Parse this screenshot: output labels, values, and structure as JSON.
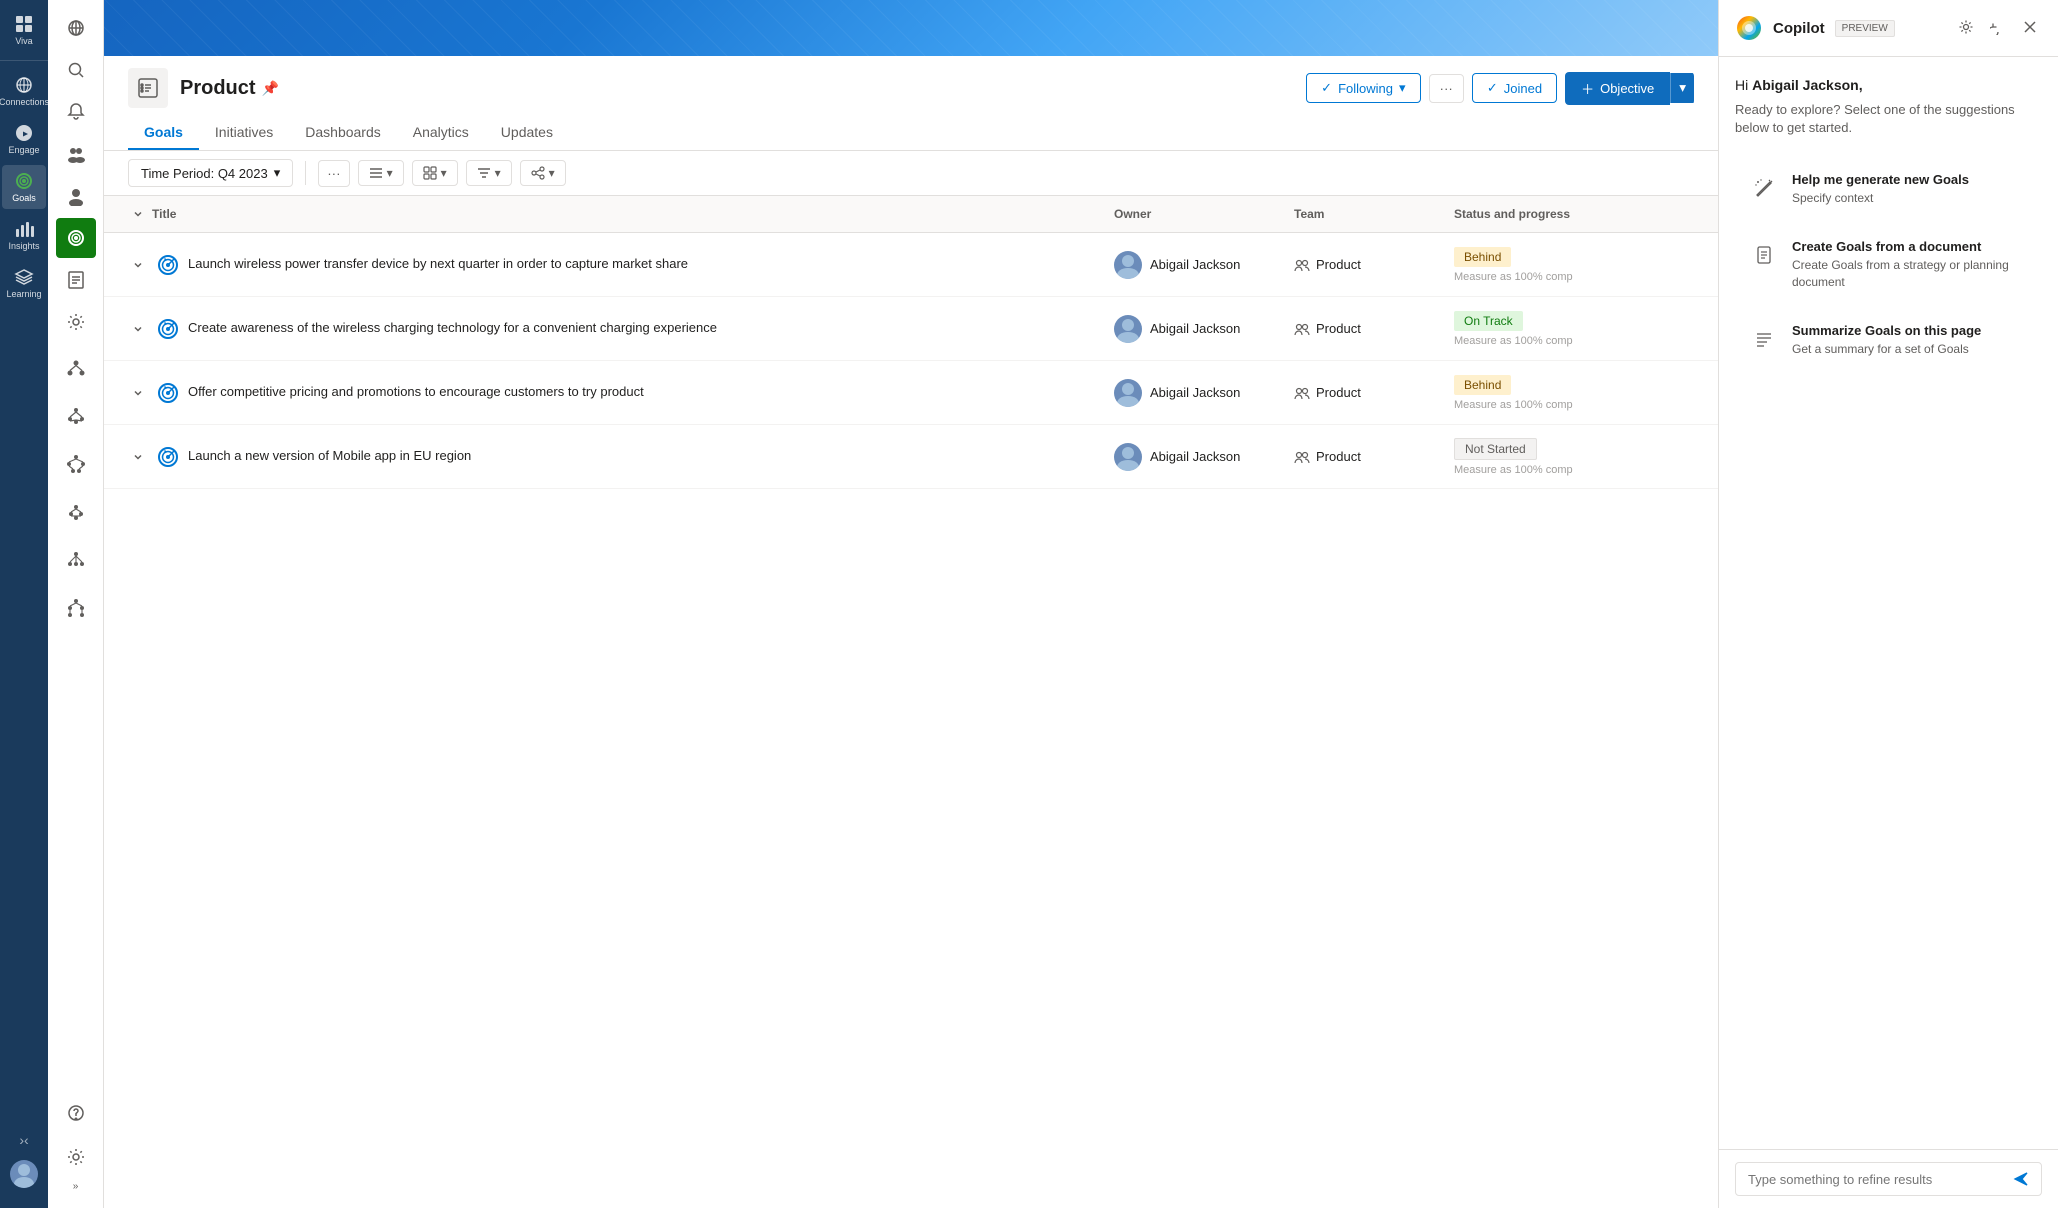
{
  "app": {
    "title": "Goals"
  },
  "far_left_nav": {
    "items": [
      {
        "id": "viva",
        "label": "Viva",
        "icon": "grid"
      },
      {
        "id": "connections",
        "label": "Connections",
        "icon": "globe"
      },
      {
        "id": "engage",
        "label": "Engage",
        "icon": "engage"
      },
      {
        "id": "goals",
        "label": "Goals",
        "icon": "goals",
        "active": true
      },
      {
        "id": "insights",
        "label": "Insights",
        "icon": "insights"
      },
      {
        "id": "learning",
        "label": "Learning",
        "icon": "learning"
      }
    ]
  },
  "left_sidebar": {
    "icons": [
      "globe",
      "search",
      "bell",
      "team-group",
      "people",
      "report",
      "settings"
    ]
  },
  "page": {
    "title": "Product",
    "pin_icon": "📌",
    "tabs": [
      {
        "id": "goals",
        "label": "Goals",
        "active": true
      },
      {
        "id": "initiatives",
        "label": "Initiatives",
        "active": false
      },
      {
        "id": "dashboards",
        "label": "Dashboards",
        "active": false
      },
      {
        "id": "analytics",
        "label": "Analytics",
        "active": false
      },
      {
        "id": "updates",
        "label": "Updates",
        "active": false
      }
    ],
    "actions": {
      "following_label": "Following",
      "joined_label": "Joined",
      "objective_label": "Objective"
    }
  },
  "toolbar": {
    "time_period": "Time Period: Q4 2023"
  },
  "table": {
    "columns": [
      "Title",
      "Owner",
      "Team",
      "Status and progress"
    ],
    "rows": [
      {
        "id": 1,
        "title": "Launch wireless power transfer device by next quarter in order to capture market share",
        "owner": "Abigail Jackson",
        "team": "Product",
        "status": "Behind",
        "status_type": "behind",
        "measure": "Measure as 100% comp"
      },
      {
        "id": 2,
        "title": "Create awareness of the wireless charging technology for a convenient charging experience",
        "owner": "Abigail Jackson",
        "team": "Product",
        "status": "On Track",
        "status_type": "on-track",
        "measure": "Measure as 100% comp"
      },
      {
        "id": 3,
        "title": "Offer competitive pricing and promotions to encourage customers to try product",
        "owner": "Abigail Jackson",
        "team": "Product",
        "status": "Behind",
        "status_type": "behind",
        "measure": "Measure as 100% comp"
      },
      {
        "id": 4,
        "title": "Launch a new version of Mobile app in EU region",
        "owner": "Abigail Jackson",
        "team": "Product",
        "status": "Not Started",
        "status_type": "not-started",
        "measure": "Measure as 100% comp"
      }
    ]
  },
  "copilot": {
    "title": "Copilot",
    "preview_badge": "PREVIEW",
    "greeting": "Hi Abigail Jackson,",
    "subtext": "Ready to explore? Select one of the suggestions below to get started.",
    "suggestions": [
      {
        "id": "generate",
        "icon": "wand",
        "title": "Help me generate new Goals",
        "description": "Specify context"
      },
      {
        "id": "from-doc",
        "icon": "document",
        "title": "Create Goals from a document",
        "description": "Create Goals from a strategy or planning document"
      },
      {
        "id": "summarize",
        "icon": "list",
        "title": "Summarize Goals on this page",
        "description": "Get a summary for a set of Goals"
      }
    ],
    "input_placeholder": "Type something to refine results"
  }
}
